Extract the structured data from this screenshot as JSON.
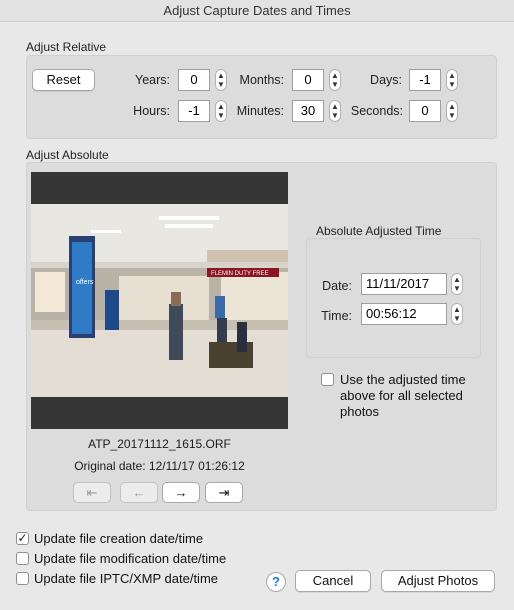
{
  "window": {
    "title": "Adjust Capture Dates and Times"
  },
  "relative": {
    "section_label": "Adjust Relative",
    "reset_label": "Reset",
    "years_label": "Years:",
    "years_value": "0",
    "months_label": "Months:",
    "months_value": "0",
    "days_label": "Days:",
    "days_value": "-1",
    "hours_label": "Hours:",
    "hours_value": "-1",
    "minutes_label": "Minutes:",
    "minutes_value": "30",
    "seconds_label": "Seconds:",
    "seconds_value": "0"
  },
  "absolute": {
    "section_label": "Adjust Absolute",
    "filename": "ATP_20171112_1615.ORF",
    "original_date": "Original date: 12/11/17 01:26:12",
    "adjusted_group_label": "Absolute Adjusted Time",
    "date_label": "Date:",
    "date_value": "11/11/2017",
    "time_label": "Time:",
    "time_value": "00:56:12",
    "use_for_all_label_1": "Use the adjusted time",
    "use_for_all_label_2": "above for all selected",
    "use_for_all_label_3": "photos",
    "nav": {
      "first": "⇤",
      "prev": "←",
      "next": "→",
      "last": "⇥"
    },
    "photo_sign_text": "FLEMIN  DUTY FREE",
    "photo_pillar_text": "offers"
  },
  "options": {
    "creation_label": "Update file creation date/time",
    "creation_checked": true,
    "modification_label": "Update file modification date/time",
    "modification_checked": false,
    "iptc_label": "Update file IPTC/XMP date/time",
    "iptc_checked": false
  },
  "footer": {
    "help_label": "?",
    "cancel_label": "Cancel",
    "adjust_label": "Adjust Photos"
  },
  "colors": {
    "help_blue": "#1e7ce6"
  }
}
